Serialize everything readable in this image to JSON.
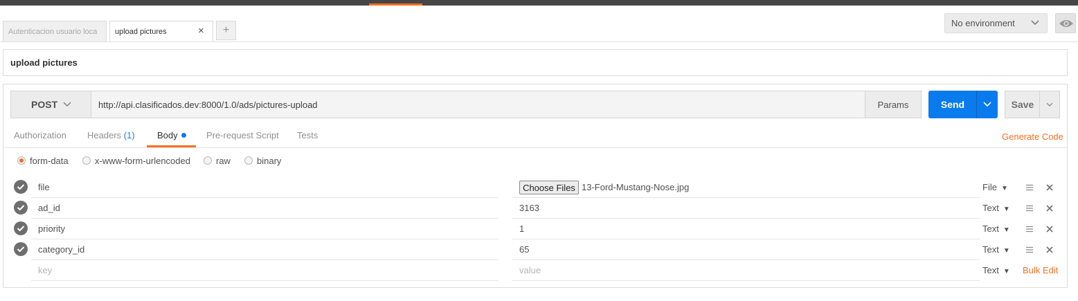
{
  "tabs": [
    {
      "label": "Autenticacion usuario loca"
    },
    {
      "label": "upload pictures"
    }
  ],
  "tab_add_label": "+",
  "environment": {
    "selected": "No environment"
  },
  "request": {
    "name": "upload pictures",
    "method": "POST",
    "url": "http://api.clasificados.dev:8000/1.0/ads/pictures-upload",
    "params_label": "Params",
    "send_label": "Send",
    "save_label": "Save"
  },
  "subtabs": {
    "authorization": "Authorization",
    "headers": "Headers",
    "headers_count": "(1)",
    "body": "Body",
    "pre_request": "Pre-request Script",
    "tests": "Tests",
    "generate_code": "Generate Code"
  },
  "body_modes": [
    "form-data",
    "x-www-form-urlencoded",
    "raw",
    "binary"
  ],
  "selected_body_mode": "form-data",
  "form_rows": [
    {
      "key": "file",
      "value": "13-Ford-Mustang-Nose.jpg",
      "type": "File",
      "choose_files_label": "Choose Files"
    },
    {
      "key": "ad_id",
      "value": "3163",
      "type": "Text"
    },
    {
      "key": "priority",
      "value": "1",
      "type": "Text"
    },
    {
      "key": "category_id",
      "value": "65",
      "type": "Text"
    }
  ],
  "new_row": {
    "key_placeholder": "key",
    "value_placeholder": "value",
    "type": "Text"
  },
  "bulk_edit_label": "Bulk Edit",
  "colors": {
    "accent": "#f47023",
    "send_blue": "#097bed",
    "top_bar": "#464646"
  },
  "icons": [
    "close-icon",
    "plus-icon",
    "chevron-down-icon",
    "eye-icon",
    "check-icon",
    "drag-handle-icon",
    "delete-icon"
  ]
}
